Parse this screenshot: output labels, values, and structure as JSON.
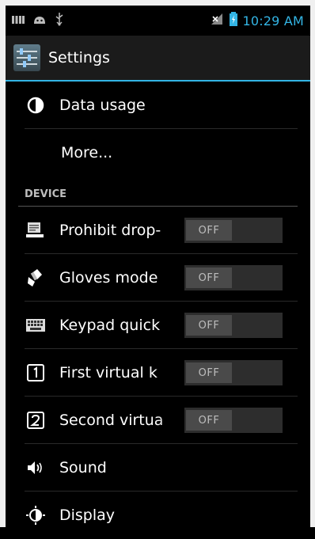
{
  "status_bar": {
    "time": "10:29 AM"
  },
  "action_bar": {
    "title": "Settings"
  },
  "items": [
    {
      "label": "Data usage",
      "icon": "data-usage-icon"
    },
    {
      "label": "More..."
    }
  ],
  "section": {
    "title": "DEVICE"
  },
  "device_items": [
    {
      "label": "Prohibit drop-",
      "icon": "prohibit-drop-icon",
      "switch": "OFF"
    },
    {
      "label": "Gloves mode",
      "icon": "glove-icon",
      "switch": "OFF"
    },
    {
      "label": "Keypad quick",
      "icon": "keypad-icon",
      "switch": "OFF"
    },
    {
      "label": "First virtual k",
      "icon": "number-one-icon",
      "switch": "OFF"
    },
    {
      "label": "Second virtua",
      "icon": "number-two-icon",
      "switch": "OFF"
    },
    {
      "label": "Sound",
      "icon": "sound-icon"
    },
    {
      "label": "Display",
      "icon": "display-icon"
    }
  ],
  "colors": {
    "accent": "#33b5e5",
    "background": "#000000"
  }
}
